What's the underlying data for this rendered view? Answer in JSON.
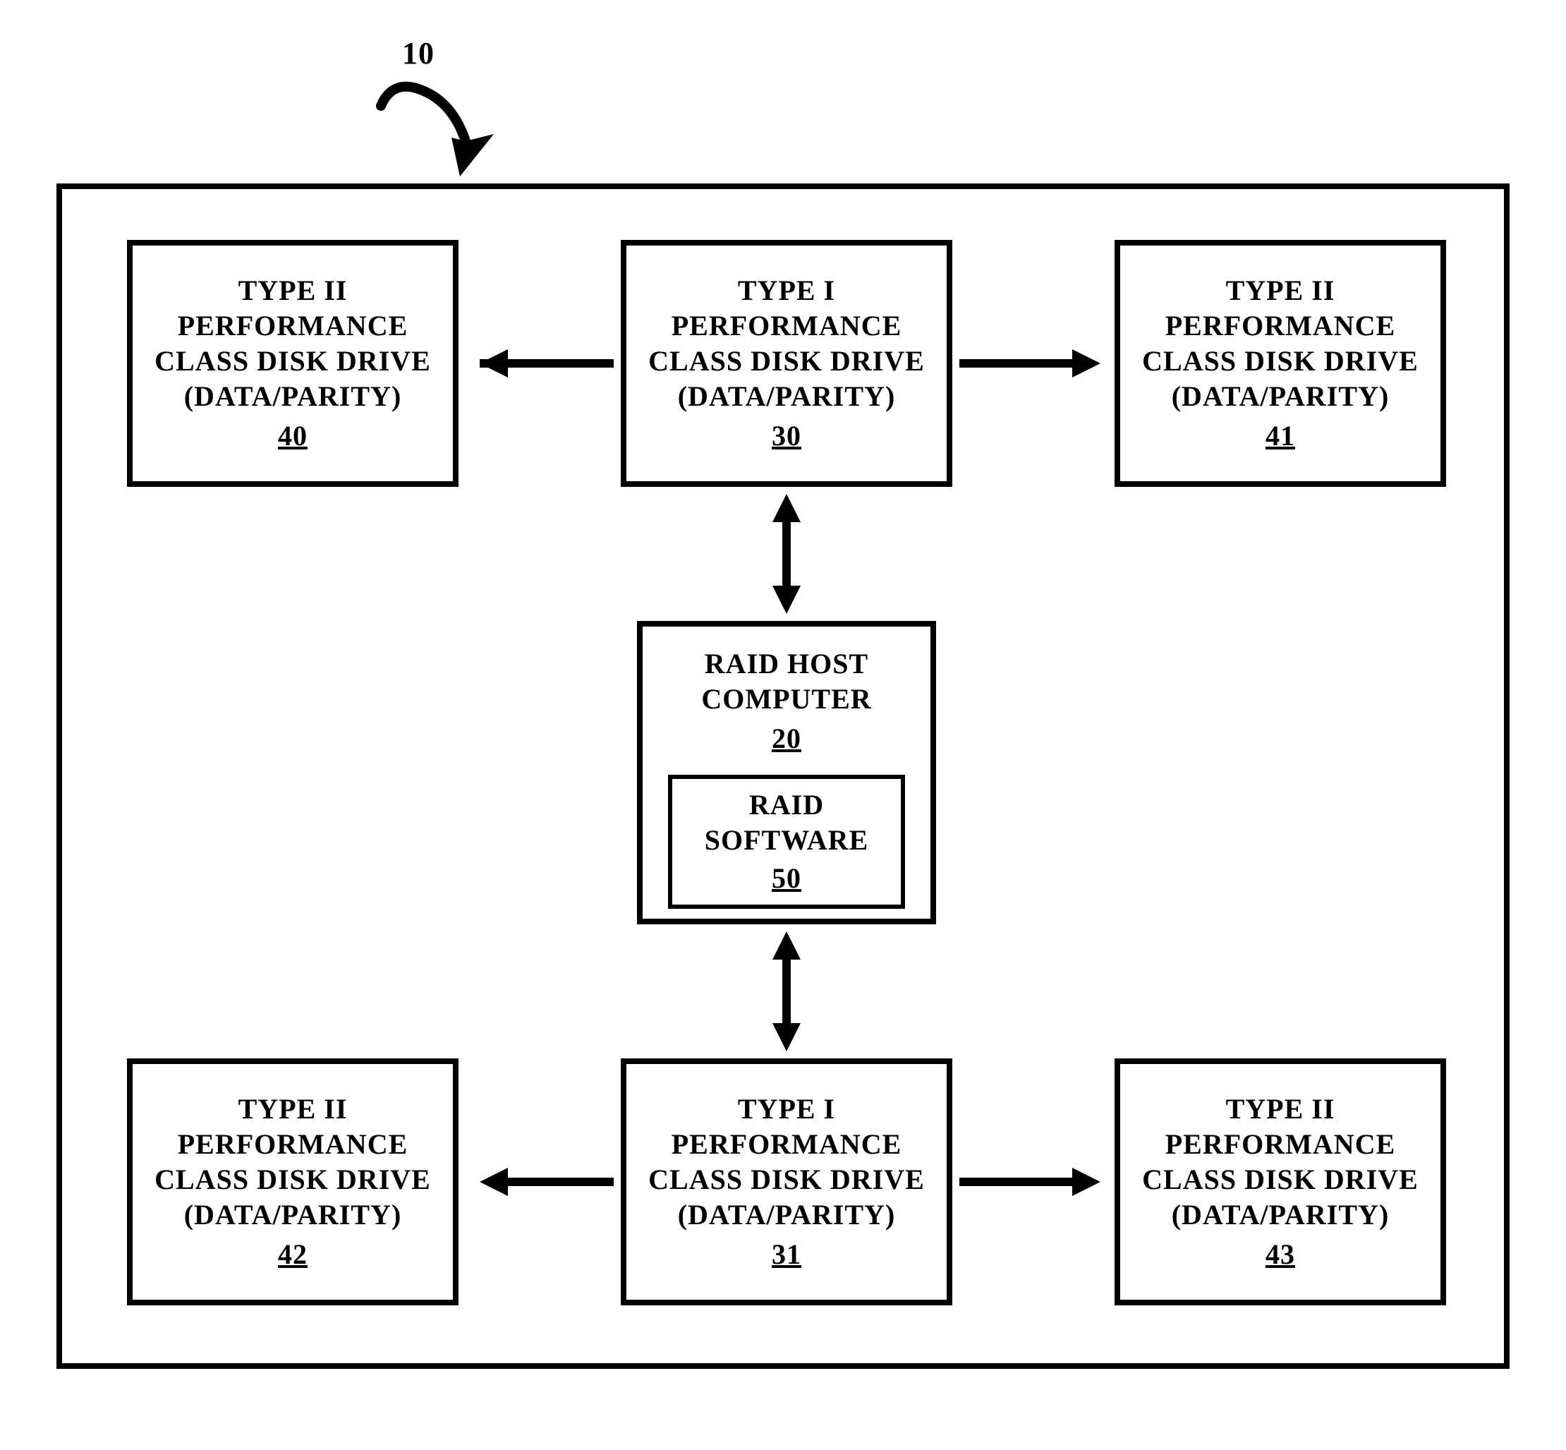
{
  "figure": {
    "ref_label": "10"
  },
  "boxes": {
    "top_left": {
      "line1": "TYPE II",
      "line2": "PERFORMANCE",
      "line3": "CLASS DISK DRIVE",
      "line4": "(DATA/PARITY)",
      "ref": "40"
    },
    "top_center": {
      "line1": "TYPE I",
      "line2": "PERFORMANCE",
      "line3": "CLASS DISK DRIVE",
      "line4": "(DATA/PARITY)",
      "ref": "30"
    },
    "top_right": {
      "line1": "TYPE II",
      "line2": "PERFORMANCE",
      "line3": "CLASS DISK DRIVE",
      "line4": "(DATA/PARITY)",
      "ref": "41"
    },
    "host": {
      "line1": "RAID HOST",
      "line2": "COMPUTER",
      "ref": "20"
    },
    "software": {
      "line1": "RAID",
      "line2": "SOFTWARE",
      "ref": "50"
    },
    "bottom_left": {
      "line1": "TYPE II",
      "line2": "PERFORMANCE",
      "line3": "CLASS DISK DRIVE",
      "line4": "(DATA/PARITY)",
      "ref": "42"
    },
    "bottom_center": {
      "line1": "TYPE I",
      "line2": "PERFORMANCE",
      "line3": "CLASS DISK DRIVE",
      "line4": "(DATA/PARITY)",
      "ref": "31"
    },
    "bottom_right": {
      "line1": "TYPE II",
      "line2": "PERFORMANCE",
      "line3": "CLASS DISK DRIVE",
      "line4": "(DATA/PARITY)",
      "ref": "43"
    }
  }
}
